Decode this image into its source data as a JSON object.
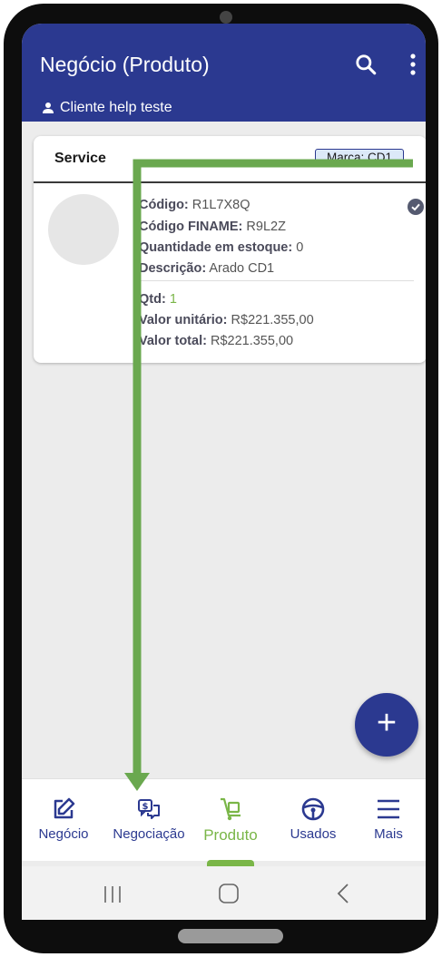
{
  "header": {
    "title": "Negócio (Produto)",
    "client": "Cliente help teste",
    "search_icon": "search-icon",
    "more_icon": "more-vert-icon",
    "background": "#2b3990"
  },
  "card": {
    "section": "Service",
    "brand_badge": "Marca: CD1",
    "fields": {
      "codigo_label": "Código:",
      "codigo_value": "R1L7X8Q",
      "finame_label": "Código FINAME:",
      "finame_value": "R9L2Z",
      "estoque_label": "Quantidade em estoque:",
      "estoque_value": "0",
      "descricao_label": "Descrição:",
      "descricao_value": "Arado CD1",
      "qtd_label": "Qtd:",
      "qtd_value": "1",
      "unitario_label": "Valor unitário:",
      "unitario_value": "R$221.355,00",
      "total_label": "Valor total:",
      "total_value": "R$221.355,00"
    }
  },
  "fab": {
    "label": "+"
  },
  "bottom_nav": {
    "items": [
      {
        "label": "Negócio",
        "icon": "edit-icon"
      },
      {
        "label": "Negociação",
        "icon": "negotiation-icon"
      },
      {
        "label": "Produto",
        "icon": "hand-truck-icon",
        "active": true
      },
      {
        "label": "Usados",
        "icon": "steering-wheel-icon"
      },
      {
        "label": "Mais",
        "icon": "menu-icon"
      }
    ]
  },
  "colors": {
    "primary": "#2b3990",
    "accent": "#7ab648",
    "annotation_arrow": "#6aa84f"
  }
}
